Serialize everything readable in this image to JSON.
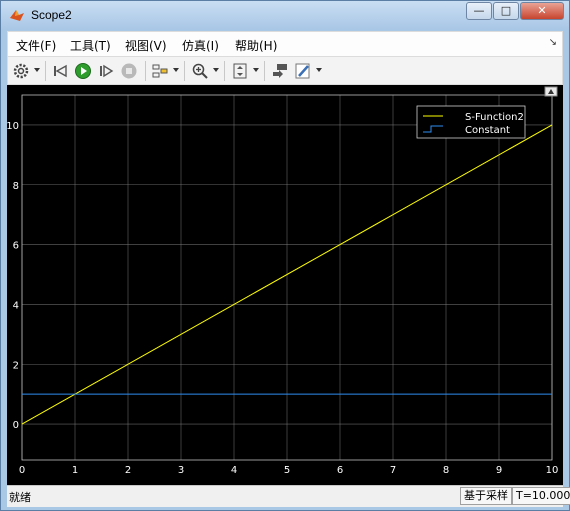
{
  "window": {
    "title": "Scope2"
  },
  "menu": [
    "文件(F)",
    "工具(T)",
    "视图(V)",
    "仿真(I)",
    "帮助(H)"
  ],
  "toolbar_icons": [
    "gear-icon",
    "step-back-icon",
    "run-icon",
    "step-forward-icon",
    "stop-icon",
    "layout-icon",
    "zoom-icon",
    "scale-axes-icon",
    "highlight-block-icon",
    "edit-icon"
  ],
  "status": {
    "text": "就绪",
    "mode": "基于采样",
    "time": "T=10.000"
  },
  "colors": {
    "sfunction": "#ffff00",
    "constant": "#2e8ef0",
    "grid": "#7f7f7f",
    "axes_text": "#ffffff"
  },
  "chart_data": {
    "type": "line",
    "xlabel": "",
    "ylabel": "",
    "xlim": [
      0,
      10
    ],
    "ylim": [
      -1.2,
      11
    ],
    "xticks": [
      0,
      1,
      2,
      3,
      4,
      5,
      6,
      7,
      8,
      9,
      10
    ],
    "yticks": [
      0,
      2,
      4,
      6,
      8,
      10
    ],
    "grid": true,
    "legend_position": "top-right",
    "series": [
      {
        "name": "S-Function2",
        "x": [
          0,
          10
        ],
        "y": [
          0,
          10
        ],
        "style": "line"
      },
      {
        "name": "Constant",
        "x": [
          0,
          10
        ],
        "y": [
          1,
          1
        ],
        "style": "step"
      }
    ]
  }
}
